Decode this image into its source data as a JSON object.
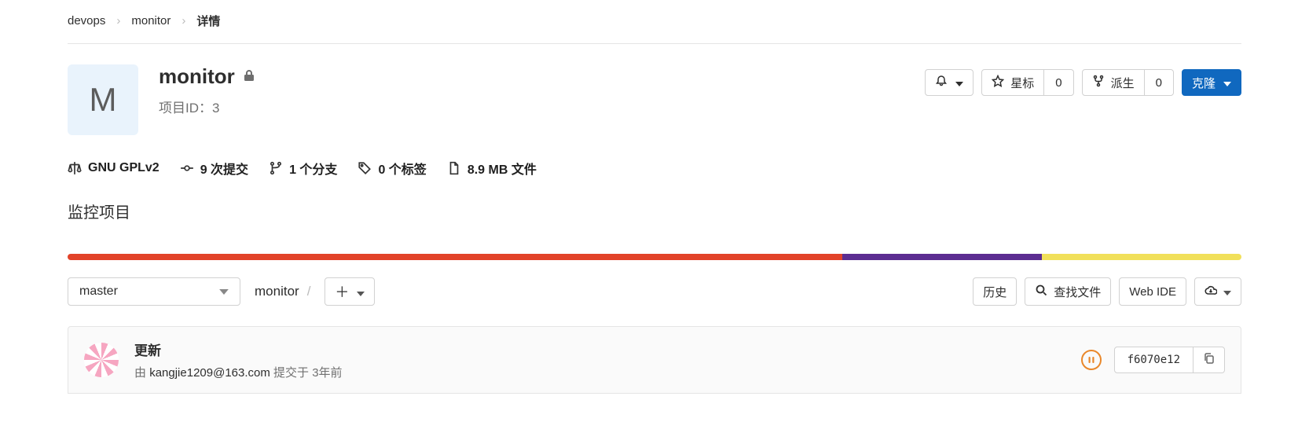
{
  "breadcrumb": {
    "items": [
      "devops",
      "monitor"
    ],
    "current": "详情"
  },
  "project": {
    "avatar_letter": "M",
    "name": "monitor",
    "id_label": "项目ID：3"
  },
  "actions": {
    "star_label": "星标",
    "star_count": "0",
    "fork_label": "派生",
    "fork_count": "0",
    "clone_label": "克隆"
  },
  "stats": {
    "license": "GNU GPLv2",
    "commits_count": "9",
    "commits_suffix": "次提交",
    "branches_count": "1",
    "branches_suffix": "个分支",
    "tags_count": "0",
    "tags_suffix": "个标签",
    "files_size": "8.9 MB",
    "files_suffix": "文件"
  },
  "description": "监控项目",
  "languages": [
    {
      "color": "#e24329",
      "pct": 66
    },
    {
      "color": "#5c2d91",
      "pct": 17
    },
    {
      "color": "#f1e05a",
      "pct": 17
    }
  ],
  "file_nav": {
    "branch": "master",
    "path": "monitor",
    "history_label": "历史",
    "find_label": "查找文件",
    "webide_label": "Web IDE"
  },
  "last_commit": {
    "title": "更新",
    "by_prefix": "由",
    "author": "kangjie1209@163.com",
    "committed_at_prefix": "提交于",
    "time_ago": "3年前",
    "sha_short": "f6070e12"
  }
}
